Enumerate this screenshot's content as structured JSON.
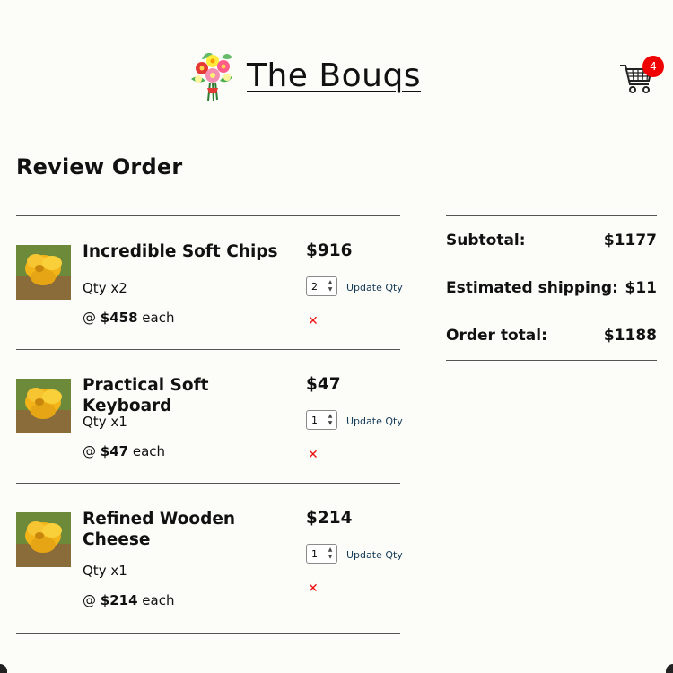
{
  "header": {
    "brand_name": "The Bouqs",
    "logo_icon": "flower-bouquet-icon",
    "cart_icon": "shopping-cart-icon",
    "cart_count": "4",
    "badge_color": "#f10000"
  },
  "page": {
    "title": "Review Order"
  },
  "items": [
    {
      "name": "Incredible Soft Chips",
      "qty_prefix": "Qty x2",
      "each_at": "@ ",
      "each_price": "$458",
      "each_suffix": " each",
      "total": "$916",
      "qty_value": "2",
      "update_label": "Update Qty",
      "remove_icon": "remove-x-icon",
      "thumbnail_icon": "yellow-flower-icon"
    },
    {
      "name": "Practical Soft Keyboard",
      "qty_prefix": "Qty x1",
      "each_at": "@ ",
      "each_price": "$47",
      "each_suffix": " each",
      "total": "$47",
      "qty_value": "1",
      "update_label": "Update Qty",
      "remove_icon": "remove-x-icon",
      "thumbnail_icon": "yellow-flower-icon"
    },
    {
      "name": "Refined Wooden Cheese",
      "qty_prefix": "Qty x1",
      "each_at": "@ ",
      "each_price": "$214",
      "each_suffix": " each",
      "total": "$214",
      "qty_value": "1",
      "update_label": "Update Qty",
      "remove_icon": "remove-x-icon",
      "thumbnail_icon": "yellow-flower-icon"
    }
  ],
  "summary": {
    "subtotal_label": "Subtotal:",
    "subtotal_value": "$1177",
    "shipping_label": "Estimated shipping:",
    "shipping_value": "$11",
    "total_label": "Order total:",
    "total_value": "$1188"
  },
  "colors": {
    "background": "#fcfcf9",
    "remove": "#ee1111",
    "link": "#133a57"
  }
}
